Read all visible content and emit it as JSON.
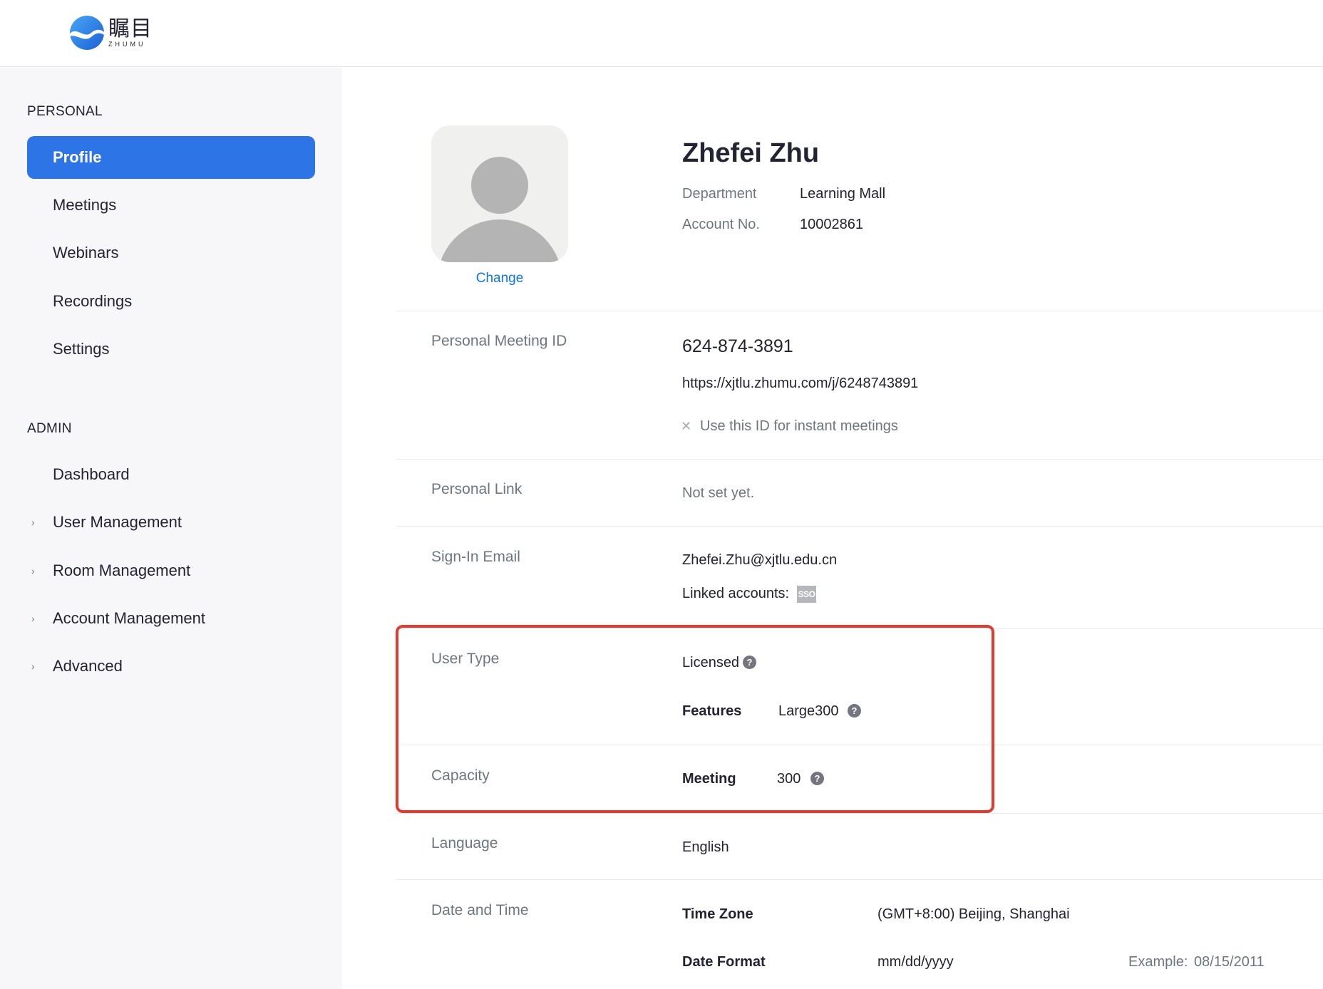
{
  "app": {
    "logo_cn": "瞩目",
    "logo_en": "ZHUMU"
  },
  "sidebar": {
    "personal_title": "PERSONAL",
    "personal_items": [
      {
        "label": "Profile",
        "active": true
      },
      {
        "label": "Meetings"
      },
      {
        "label": "Webinars"
      },
      {
        "label": "Recordings"
      },
      {
        "label": "Settings"
      }
    ],
    "admin_title": "ADMIN",
    "admin_items": [
      {
        "label": "Dashboard"
      },
      {
        "label": "User Management",
        "expandable": true
      },
      {
        "label": "Room Management",
        "expandable": true
      },
      {
        "label": "Account Management",
        "expandable": true
      },
      {
        "label": "Advanced",
        "expandable": true
      }
    ]
  },
  "profile": {
    "change_label": "Change",
    "name": "Zhefei Zhu",
    "department_label": "Department",
    "department_value": "Learning Mall",
    "account_label": "Account No.",
    "account_value": "10002861"
  },
  "pmi": {
    "label": "Personal Meeting ID",
    "id": "624-874-3891",
    "url": "https://xjtlu.zhumu.com/j/6248743891",
    "instant_label": "Use this ID for instant meetings",
    "instant_enabled": false
  },
  "personal_link": {
    "label": "Personal Link",
    "value": "Not set yet."
  },
  "sign_in": {
    "label": "Sign-In Email",
    "email": "Zhefei.Zhu@xjtlu.edu.cn",
    "linked_label": "Linked accounts:",
    "linked_badge": "SSO"
  },
  "user_type": {
    "label": "User Type",
    "value": "Licensed",
    "features_label": "Features",
    "features_value": "Large300"
  },
  "capacity": {
    "label": "Capacity",
    "meeting_label": "Meeting",
    "meeting_value": "300"
  },
  "language": {
    "label": "Language",
    "value": "English"
  },
  "date_time": {
    "label": "Date and Time",
    "tz_label": "Time Zone",
    "tz_value": "(GMT+8:00) Beijing, Shanghai",
    "format_label": "Date Format",
    "format_value": "mm/dd/yyyy",
    "example_label": "Example:",
    "example_value": "08/15/2011"
  },
  "colors": {
    "accent": "#2d75e6",
    "link": "#0e72ed",
    "highlight": "#e23b30"
  }
}
